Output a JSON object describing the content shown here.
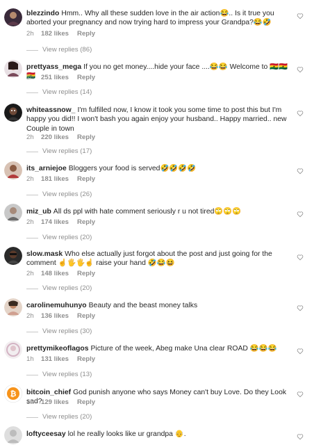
{
  "colors": {
    "text": "#262626",
    "muted": "#8e8e8e",
    "line": "#c7c7c7"
  },
  "icons": {
    "like": "heart-outline-icon"
  },
  "comments": [
    {
      "username": "blezzindo",
      "text": "Hmm.. Why all these sudden love in the air action😂.. Is it true you aborted your pregnancy and now trying hard to impress your Grandpa?😂🤣",
      "time": "2h",
      "likes": "182 likes",
      "reply": "Reply",
      "view_replies": "View replies (86)"
    },
    {
      "username": "prettyass_mega",
      "text": "If you no get money....hide your face ....😂😂 Welcome to 🇬🇭🇬🇭🇬🇭",
      "time": "2h",
      "likes": "251 likes",
      "reply": "Reply",
      "view_replies": "View replies (14)"
    },
    {
      "username": "whiteassnow_",
      "text": "I'm fulfilled now, I know it took you some time to post this but I'm happy you did!! I won't bash you again enjoy your husband.. Happy married.. new Couple in town",
      "time": "2h",
      "likes": "220 likes",
      "reply": "Reply",
      "view_replies": "View replies (17)"
    },
    {
      "username": "its_arniejoe",
      "text": "Bloggers your food is served🤣🤣🤣🤣",
      "time": "2h",
      "likes": "181 likes",
      "reply": "Reply",
      "view_replies": "View replies (26)"
    },
    {
      "username": "miz_ub",
      "text": "All ds ppl with hate comment seriously r u not tired🙄🙄🙄",
      "time": "2h",
      "likes": "174 likes",
      "reply": "Reply",
      "view_replies": "View replies (20)"
    },
    {
      "username": "slow.mask",
      "text": "Who else actually just forgot about the post and just going for the comment ☝🖐🖐☝ raise your hand 🤣😂😆",
      "time": "2h",
      "likes": "148 likes",
      "reply": "Reply",
      "view_replies": "View replies (20)"
    },
    {
      "username": "carolinemuhunyo",
      "text": "Beauty and the beast money talks",
      "time": "2h",
      "likes": "136 likes",
      "reply": "Reply",
      "view_replies": "View replies (30)"
    },
    {
      "username": "prettymikeoflagos",
      "text": "Picture of the week, Abeg make Una clear ROAD 😂😂😂",
      "time": "1h",
      "likes": "131 likes",
      "reply": "Reply",
      "view_replies": "View replies (13)"
    },
    {
      "username": "bitcoin_chief",
      "text": "God punish anyone who says Money can't buy Love. Do they Look sad?",
      "time": "1h",
      "likes": "129 likes",
      "reply": "Reply",
      "view_replies": "View replies (20)"
    },
    {
      "username": "loftyceesay",
      "text": "lol he really looks like ur grandpa 👴.",
      "time": "",
      "likes": "",
      "reply": "",
      "view_replies": ""
    }
  ]
}
